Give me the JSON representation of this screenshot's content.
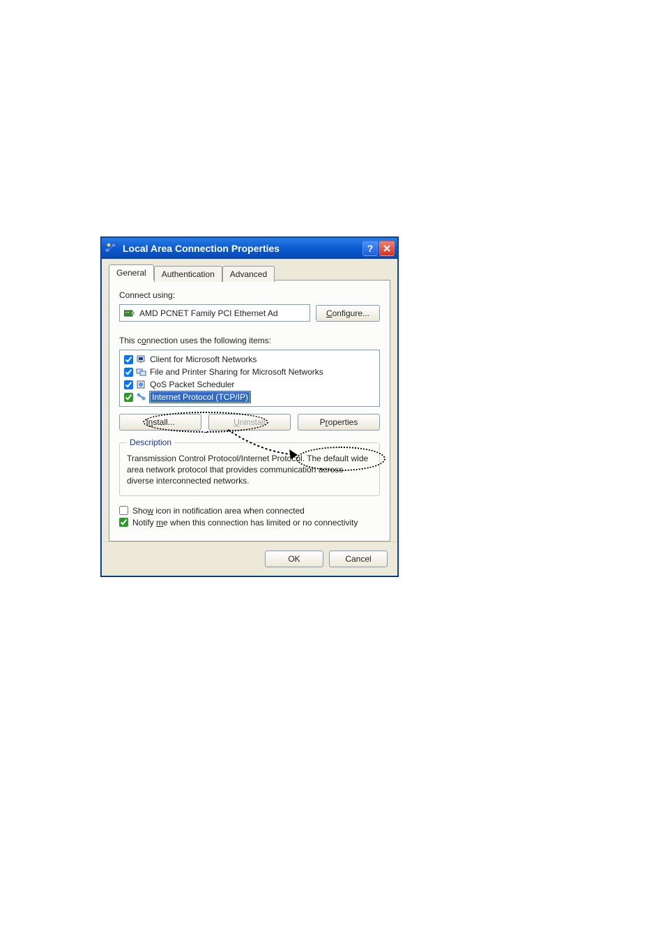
{
  "window": {
    "title": "Local Area Connection Properties"
  },
  "tabs": {
    "general": "General",
    "authentication": "Authentication",
    "advanced": "Advanced"
  },
  "connect_using_label": "Connect using:",
  "adapter_name": "AMD PCNET Family PCI Ethernet Ad",
  "configure_btn": "Configure...",
  "items_label": "This connection uses the following items:",
  "items": [
    {
      "label": "Client for Microsoft Networks",
      "checked": true,
      "selected": false
    },
    {
      "label": "File and Printer Sharing for Microsoft Networks",
      "checked": true,
      "selected": false
    },
    {
      "label": "QoS Packet Scheduler",
      "checked": true,
      "selected": false
    },
    {
      "label": "Internet Protocol (TCP/IP)",
      "checked": true,
      "selected": true
    }
  ],
  "buttons": {
    "install": "Install...",
    "uninstall": "Uninstall",
    "properties": "Properties"
  },
  "description": {
    "legend": "Description",
    "text": "Transmission Control Protocol/Internet Protocol. The default wide area network protocol that provides communication across diverse interconnected networks."
  },
  "options": {
    "show_icon": {
      "label": "Show icon in notification area when connected",
      "checked": false
    },
    "notify": {
      "label": "Notify me when this connection has limited or no connectivity",
      "checked": true
    }
  },
  "footer": {
    "ok": "OK",
    "cancel": "Cancel"
  }
}
